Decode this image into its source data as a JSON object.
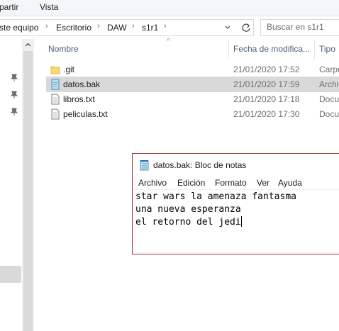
{
  "ribbon": {
    "tabs": [
      "partir",
      "Vista"
    ]
  },
  "address": {
    "crumbs": [
      "ste equipo",
      "Escritorio",
      "DAW",
      "s1r1"
    ],
    "search_placeholder": "Buscar en s1r1"
  },
  "columns": {
    "name": "Nombre",
    "date": "Fecha de modifica...",
    "type": "Tipo"
  },
  "files": [
    {
      "name": ".git",
      "date": "21/01/2020 17:52",
      "type": "Carpe",
      "icon": "folder-icon",
      "selected": false
    },
    {
      "name": "datos.bak",
      "date": "21/01/2020 17:59",
      "type": "Archi",
      "icon": "notepad-file-icon",
      "selected": true
    },
    {
      "name": "libros.txt",
      "date": "21/01/2020 17:18",
      "type": "Docu",
      "icon": "text-file-icon",
      "selected": false
    },
    {
      "name": "peliculas.txt",
      "date": "21/01/2020 17:30",
      "type": "Docu",
      "icon": "text-file-icon",
      "selected": false
    }
  ],
  "notepad": {
    "title": "datos.bak: Bloc de notas",
    "menu": [
      "Archivo",
      "Edición",
      "Formato",
      "Ver",
      "Ayuda"
    ],
    "lines": [
      "star wars la amenaza fantasma",
      "una nueva esperanza",
      "el retorno del jedi"
    ]
  },
  "colors": {
    "selection": "#d9d9d9",
    "header_text": "#4c607a",
    "notepad_border": "#a4373a",
    "folder": "#f8d775"
  }
}
